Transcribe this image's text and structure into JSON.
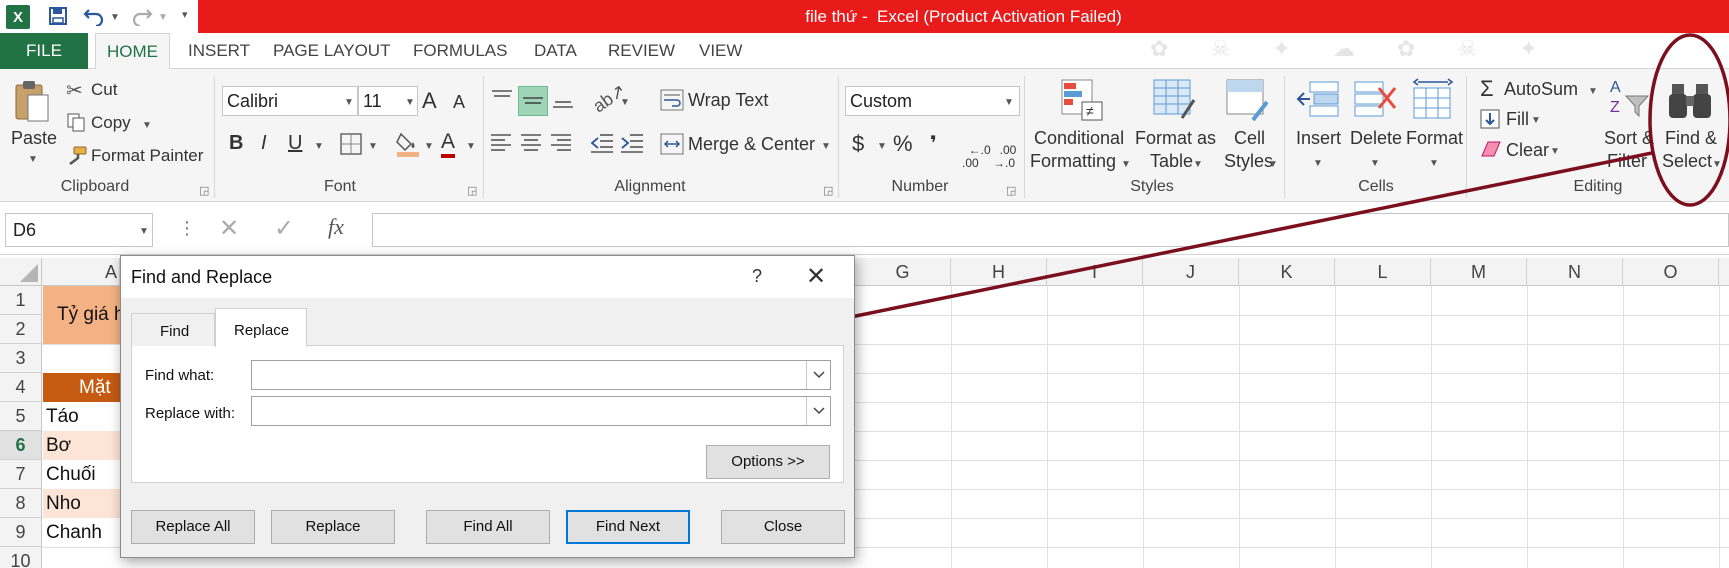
{
  "window": {
    "title": "file thứ -  Excel (Product Activation Failed)",
    "excel_logo_letter": "X",
    "accent": "#217346",
    "titlebar_color": "#e81a1a"
  },
  "menu": {
    "file": "FILE",
    "home": "HOME",
    "insert": "INSERT",
    "page_layout": "PAGE LAYOUT",
    "formulas": "FORMULAS",
    "data": "DATA",
    "review": "REVIEW",
    "view": "VIEW"
  },
  "ribbon": {
    "clipboard": {
      "group": "Clipboard",
      "paste": "Paste",
      "cut": "Cut",
      "copy": "Copy",
      "format_painter": "Format Painter"
    },
    "font": {
      "group": "Font",
      "name": "Calibri",
      "size": "11",
      "bold": "B",
      "italic": "I",
      "underline": "U",
      "grow": "A",
      "shrink": "A",
      "color": "A"
    },
    "alignment": {
      "group": "Alignment",
      "wrap": "Wrap Text",
      "merge": "Merge & Center"
    },
    "number": {
      "group": "Number",
      "format": "Custom",
      "currency": "$",
      "percent": "%",
      "comma": "❜",
      "inc_dec": "←.0\n.00",
      "dec_dec": ".00\n→.0"
    },
    "styles": {
      "group": "Styles",
      "conditional": [
        "Conditional",
        "Formatting"
      ],
      "format_table": [
        "Format as",
        "Table"
      ],
      "cell_styles": [
        "Cell",
        "Styles"
      ]
    },
    "cells": {
      "group": "Cells",
      "insert": "Insert",
      "delete": "Delete",
      "format": "Format"
    },
    "editing": {
      "group": "Editing",
      "autosum": "AutoSum",
      "fill": "Fill",
      "clear": "Clear",
      "sort": [
        "Sort &",
        "Filter"
      ],
      "find": [
        "Find &",
        "Select"
      ]
    }
  },
  "formula_bar": {
    "name_box": "D6",
    "fx": "fx",
    "value": ""
  },
  "grid": {
    "columns": [
      "G",
      "H",
      "I",
      "J",
      "K",
      "L",
      "M",
      "N",
      "O"
    ],
    "partial_col": "A",
    "rows": [
      "1",
      "2",
      "3",
      "4",
      "5",
      "6",
      "7",
      "8",
      "9",
      "10"
    ],
    "cells": {
      "a1": "Tỷ giá h",
      "a4": "Mặt",
      "a5": "Táo",
      "a6": "Bơ",
      "a7": "Chuối",
      "a8": "Nho",
      "a9": "Chanh"
    }
  },
  "dialog": {
    "title": "Find and Replace",
    "help": "?",
    "tab_find": "Find",
    "tab_replace": "Replace",
    "find_what_label": "Find what:",
    "find_what_value": "",
    "replace_with_label": "Replace with:",
    "replace_with_value": "",
    "options": "Options >>",
    "replace_all": "Replace All",
    "replace": "Replace",
    "find_all": "Find All",
    "find_next": "Find Next",
    "close": "Close"
  }
}
